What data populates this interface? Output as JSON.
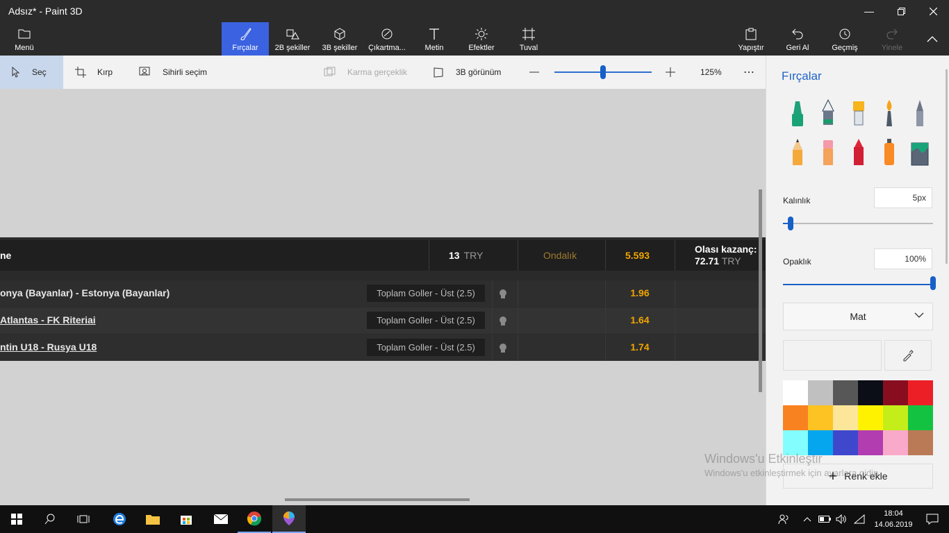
{
  "window": {
    "title": "Adsız* - Paint 3D"
  },
  "ribbon": {
    "menu": "Menü",
    "brushes": "Fırçalar",
    "shapes2d": "2B şekiller",
    "shapes3d": "3B şekiller",
    "stickers": "Çıkartma...",
    "text": "Metin",
    "effects": "Efektler",
    "canvas": "Tuval",
    "paste": "Yapıştır",
    "undo": "Geri Al",
    "history": "Geçmiş",
    "redo": "Yinele"
  },
  "toolbar": {
    "select": "Seç",
    "crop": "Kırp",
    "magic_select": "Sihirli seçim",
    "mixed_reality": "Karma gerçeklik",
    "view_3d": "3B görünüm",
    "zoom_value": "125%",
    "zoom_level": 0.5
  },
  "pasted_image": {
    "header": {
      "col1": "ne",
      "stake_amount": "13",
      "stake_currency": "TRY",
      "odds_format": "Ondalık",
      "total_odds": "5.593",
      "potential_label": "Olası kazanç:",
      "potential_amount": "72.71",
      "potential_currency": "TRY"
    },
    "rows": [
      {
        "match": "onya (Bayanlar) - Estonya (Bayanlar)",
        "market": "Toplam Goller - Üst (2.5)",
        "odds": "1.96"
      },
      {
        "match": "Atlantas - FK Riteriai",
        "market": "Toplam Goller - Üst (2.5)",
        "odds": "1.64"
      },
      {
        "match": "ntin U18 - Rusya U18",
        "market": "Toplam Goller - Üst (2.5)",
        "odds": "1.74"
      }
    ]
  },
  "panel": {
    "title": "Fırçalar",
    "thickness_label": "Kalınlık",
    "thickness_value": "5px",
    "thickness_level": 0.05,
    "opacity_label": "Opaklık",
    "opacity_value": "100%",
    "opacity_level": 1.0,
    "finish": "Mat",
    "add_color": "Renk ekle",
    "palette": [
      "#ffffff",
      "#c0c0c0",
      "#575757",
      "#0b0e16",
      "#880e1f",
      "#ec1f26",
      "#f98220",
      "#fcc323",
      "#fce69a",
      "#fff200",
      "#c3ee1a",
      "#14c242",
      "#83fdfd",
      "#05a6ee",
      "#3f48cc",
      "#b13db0",
      "#f9a9c9",
      "#bb7a56"
    ]
  },
  "watermark": {
    "title": "Windows'u Etkinleştir",
    "subtitle": "Windows'u etkinleştirmek için ayarlara gidin."
  },
  "taskbar": {
    "time": "18:04",
    "date": "14.06.2019"
  }
}
